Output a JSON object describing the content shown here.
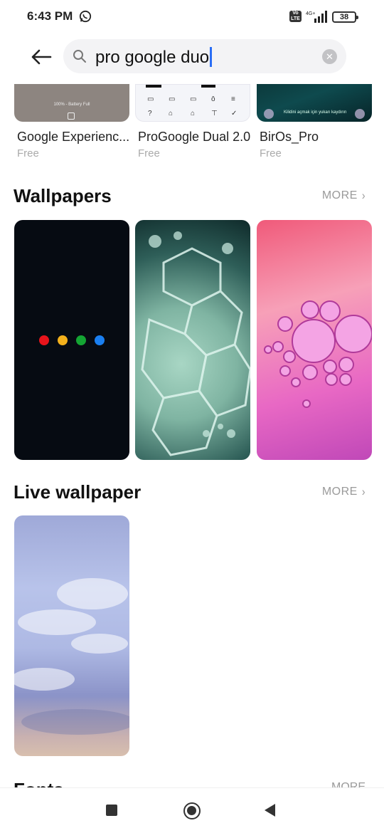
{
  "status_bar": {
    "time": "6:43 PM",
    "volte_label": "Vo LTE",
    "network_label": "4G+",
    "battery": "38"
  },
  "search": {
    "query": "pro google duo",
    "icon": "search-icon",
    "clear_icon": "close-icon"
  },
  "apps": [
    {
      "name": "Google Experienc...",
      "price": "Free",
      "thumb_text": "100% - Battery Full"
    },
    {
      "name": "ProGoogle Dual 2.0",
      "price": "Free"
    },
    {
      "name": "BirOs_Pro",
      "price": "Free",
      "thumb_text": "Kilidini açmak için yukarı kaydırın"
    }
  ],
  "sections": {
    "wallpapers": {
      "title": "Wallpapers",
      "more": "MORE"
    },
    "live_wallpaper": {
      "title": "Live wallpaper",
      "more": "MORE"
    },
    "fonts": {
      "title": "Fonts",
      "more": "MORE"
    }
  },
  "colors": {
    "accent": "#2a6ef5",
    "dots": [
      "#e8141b",
      "#f3b11c",
      "#14a533",
      "#1a7ff0"
    ]
  }
}
